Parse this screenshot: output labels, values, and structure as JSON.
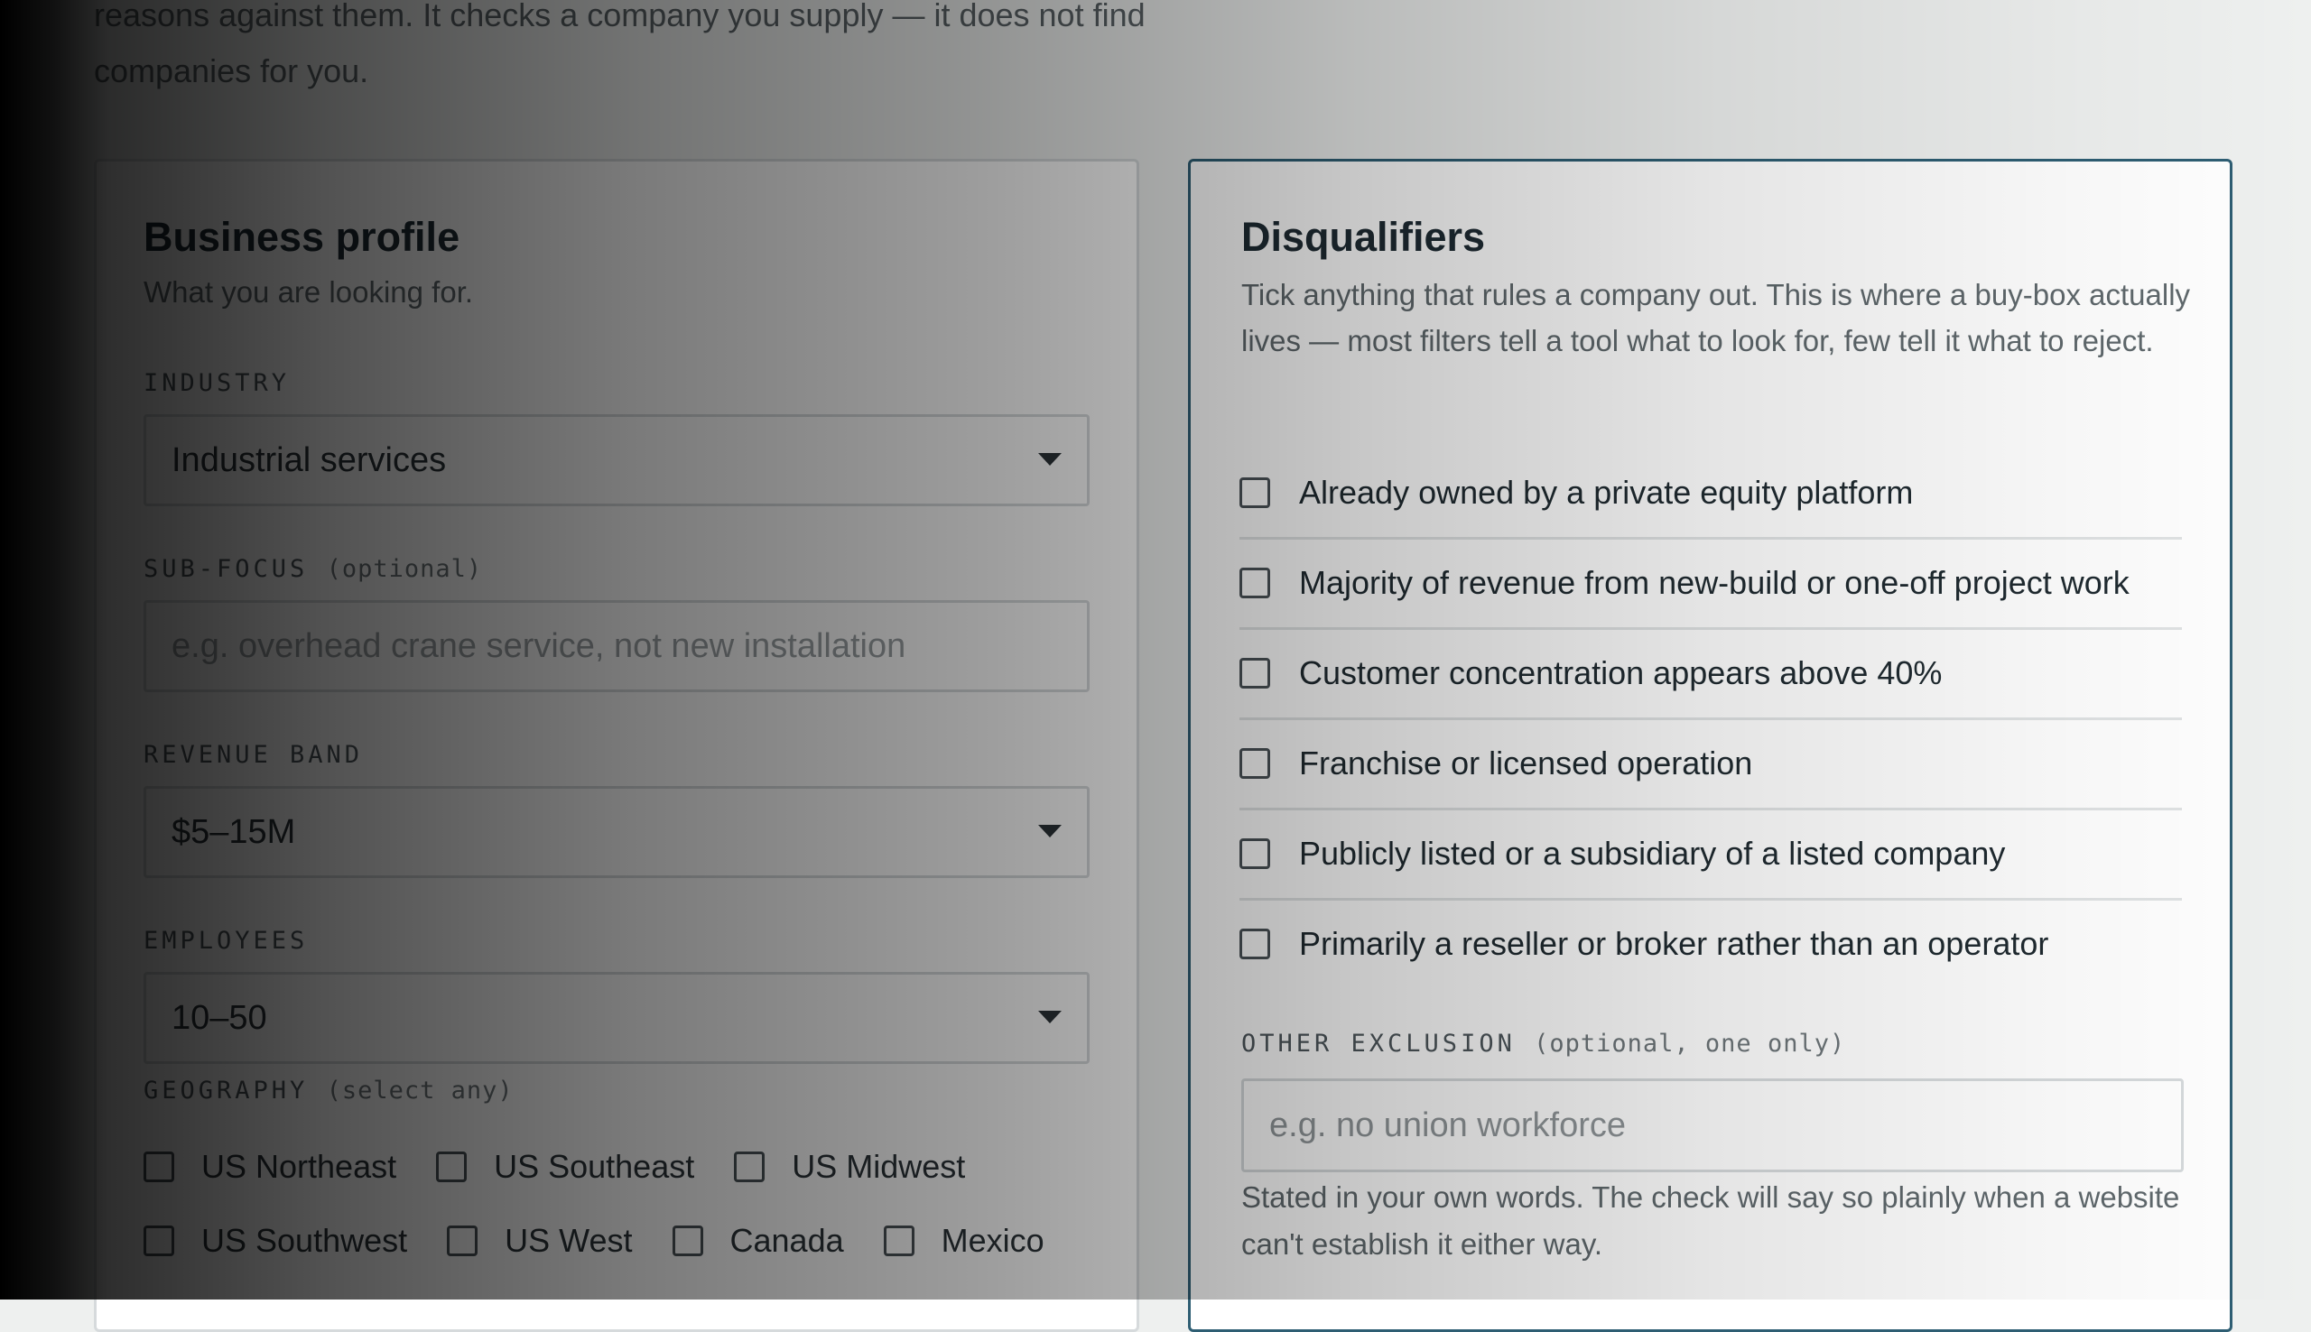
{
  "intro": {
    "line1": "reasons against them. It checks a company you supply — it does not find",
    "line2": "companies for you."
  },
  "profile": {
    "title": "Business profile",
    "subtitle": "What you are looking for.",
    "industry": {
      "label": "INDUSTRY",
      "value": "Industrial services"
    },
    "sub_focus": {
      "label": "SUB-FOCUS",
      "optional": "(optional)",
      "placeholder": "e.g. overhead crane service, not new installation"
    },
    "revenue": {
      "label": "REVENUE BAND",
      "value": "$5–15M"
    },
    "employees": {
      "label": "EMPLOYEES",
      "value": "10–50"
    },
    "geography": {
      "label": "GEOGRAPHY",
      "hint": "(select any)",
      "row1": [
        "US Northeast",
        "US Southeast",
        "US Midwest"
      ],
      "row2": [
        "US Southwest",
        "US West",
        "Canada",
        "Mexico"
      ]
    }
  },
  "disqualifiers": {
    "title": "Disqualifiers",
    "description": "Tick anything that rules a company out. This is where a buy-box actually lives — most filters tell a tool what to look for, few tell it what to reject.",
    "items": [
      "Already owned by a private equity platform",
      "Majority of revenue from new-build or one-off project work",
      "Customer concentration appears above 40%",
      "Franchise or licensed operation",
      "Publicly listed or a subsidiary of a listed company",
      "Primarily a reseller or broker rather than an operator"
    ],
    "other": {
      "label": "OTHER EXCLUSION",
      "hint": "(optional, one only)",
      "placeholder": "e.g. no union workforce",
      "note": "Stated in your own words. The check will say so plainly when a website can't establish it either way."
    }
  },
  "colors": {
    "accent_border": "#2e5e73",
    "card_border": "#d6dadc"
  }
}
